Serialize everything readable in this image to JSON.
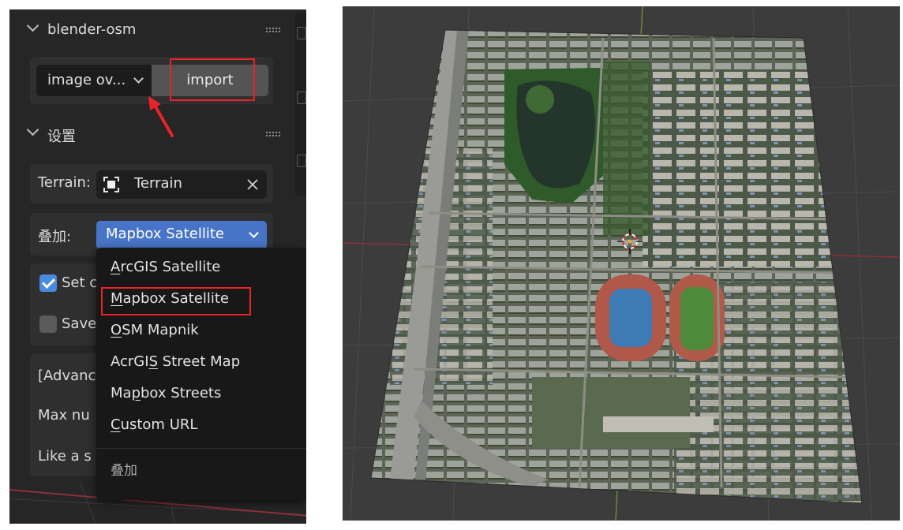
{
  "panel": {
    "section1_title": "blender-osm",
    "mode_dropdown_value": "image ov...",
    "import_label": "import",
    "section2_title": "设置",
    "terrain_label": "Terrain:",
    "terrain_value": "Terrain",
    "overlay_label": "叠加:",
    "overlay_value": "Mapbox Satellite",
    "set_checkbox_label": "Set c",
    "save_checkbox_label": "Save",
    "advanced_label": "[Advanc",
    "max_label": "Max nu",
    "like_label": "Like a s"
  },
  "overlay_menu": {
    "items": [
      {
        "label": "ArcGIS Satellite",
        "mnemonic": "A",
        "rest": "rcGIS Satellite"
      },
      {
        "label": "Mapbox Satellite",
        "mnemonic": "M",
        "rest": "apbox Satellite"
      },
      {
        "label": "OSM Mapnik",
        "mnemonic": "O",
        "rest": "SM Mapnik"
      },
      {
        "label": "AcrGIS Street Map",
        "before": "AcrGI",
        "mnemonic": "S",
        "rest": " Street Map"
      },
      {
        "label": "Mapbox Streets",
        "before": "Ma",
        "mnemonic": "p",
        "rest": "box Streets"
      },
      {
        "label": "Custom URL",
        "mnemonic": "C",
        "rest": "ustom URL"
      }
    ],
    "footer_label": "叠加",
    "selected": "Mapbox Satellite"
  },
  "icons": {
    "terrain_object": "object-icon",
    "clear": "close-icon",
    "section_collapse": "chevron-down-icon",
    "drag_handle": "grip-icon",
    "annotation": "red-arrow"
  },
  "colors": {
    "annotation_red": "#e8232b",
    "checkbox_blue": "#4a8be0",
    "dropdown_blue": "#4874c7",
    "panel_bg": "#262626",
    "viewport_bg": "#3c3c3c"
  }
}
